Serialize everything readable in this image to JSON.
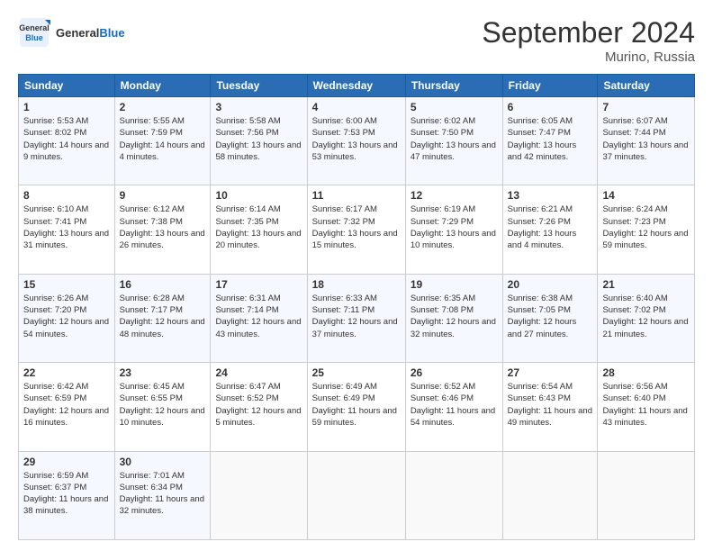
{
  "header": {
    "logo_general": "General",
    "logo_blue": "Blue",
    "month": "September 2024",
    "location": "Murino, Russia"
  },
  "days_of_week": [
    "Sunday",
    "Monday",
    "Tuesday",
    "Wednesday",
    "Thursday",
    "Friday",
    "Saturday"
  ],
  "weeks": [
    [
      {
        "num": "1",
        "sunrise": "5:53 AM",
        "sunset": "8:02 PM",
        "daylight": "14 hours and 9 minutes."
      },
      {
        "num": "2",
        "sunrise": "5:55 AM",
        "sunset": "7:59 PM",
        "daylight": "14 hours and 4 minutes."
      },
      {
        "num": "3",
        "sunrise": "5:58 AM",
        "sunset": "7:56 PM",
        "daylight": "13 hours and 58 minutes."
      },
      {
        "num": "4",
        "sunrise": "6:00 AM",
        "sunset": "7:53 PM",
        "daylight": "13 hours and 53 minutes."
      },
      {
        "num": "5",
        "sunrise": "6:02 AM",
        "sunset": "7:50 PM",
        "daylight": "13 hours and 47 minutes."
      },
      {
        "num": "6",
        "sunrise": "6:05 AM",
        "sunset": "7:47 PM",
        "daylight": "13 hours and 42 minutes."
      },
      {
        "num": "7",
        "sunrise": "6:07 AM",
        "sunset": "7:44 PM",
        "daylight": "13 hours and 37 minutes."
      }
    ],
    [
      {
        "num": "8",
        "sunrise": "6:10 AM",
        "sunset": "7:41 PM",
        "daylight": "13 hours and 31 minutes."
      },
      {
        "num": "9",
        "sunrise": "6:12 AM",
        "sunset": "7:38 PM",
        "daylight": "13 hours and 26 minutes."
      },
      {
        "num": "10",
        "sunrise": "6:14 AM",
        "sunset": "7:35 PM",
        "daylight": "13 hours and 20 minutes."
      },
      {
        "num": "11",
        "sunrise": "6:17 AM",
        "sunset": "7:32 PM",
        "daylight": "13 hours and 15 minutes."
      },
      {
        "num": "12",
        "sunrise": "6:19 AM",
        "sunset": "7:29 PM",
        "daylight": "13 hours and 10 minutes."
      },
      {
        "num": "13",
        "sunrise": "6:21 AM",
        "sunset": "7:26 PM",
        "daylight": "13 hours and 4 minutes."
      },
      {
        "num": "14",
        "sunrise": "6:24 AM",
        "sunset": "7:23 PM",
        "daylight": "12 hours and 59 minutes."
      }
    ],
    [
      {
        "num": "15",
        "sunrise": "6:26 AM",
        "sunset": "7:20 PM",
        "daylight": "12 hours and 54 minutes."
      },
      {
        "num": "16",
        "sunrise": "6:28 AM",
        "sunset": "7:17 PM",
        "daylight": "12 hours and 48 minutes."
      },
      {
        "num": "17",
        "sunrise": "6:31 AM",
        "sunset": "7:14 PM",
        "daylight": "12 hours and 43 minutes."
      },
      {
        "num": "18",
        "sunrise": "6:33 AM",
        "sunset": "7:11 PM",
        "daylight": "12 hours and 37 minutes."
      },
      {
        "num": "19",
        "sunrise": "6:35 AM",
        "sunset": "7:08 PM",
        "daylight": "12 hours and 32 minutes."
      },
      {
        "num": "20",
        "sunrise": "6:38 AM",
        "sunset": "7:05 PM",
        "daylight": "12 hours and 27 minutes."
      },
      {
        "num": "21",
        "sunrise": "6:40 AM",
        "sunset": "7:02 PM",
        "daylight": "12 hours and 21 minutes."
      }
    ],
    [
      {
        "num": "22",
        "sunrise": "6:42 AM",
        "sunset": "6:59 PM",
        "daylight": "12 hours and 16 minutes."
      },
      {
        "num": "23",
        "sunrise": "6:45 AM",
        "sunset": "6:55 PM",
        "daylight": "12 hours and 10 minutes."
      },
      {
        "num": "24",
        "sunrise": "6:47 AM",
        "sunset": "6:52 PM",
        "daylight": "12 hours and 5 minutes."
      },
      {
        "num": "25",
        "sunrise": "6:49 AM",
        "sunset": "6:49 PM",
        "daylight": "11 hours and 59 minutes."
      },
      {
        "num": "26",
        "sunrise": "6:52 AM",
        "sunset": "6:46 PM",
        "daylight": "11 hours and 54 minutes."
      },
      {
        "num": "27",
        "sunrise": "6:54 AM",
        "sunset": "6:43 PM",
        "daylight": "11 hours and 49 minutes."
      },
      {
        "num": "28",
        "sunrise": "6:56 AM",
        "sunset": "6:40 PM",
        "daylight": "11 hours and 43 minutes."
      }
    ],
    [
      {
        "num": "29",
        "sunrise": "6:59 AM",
        "sunset": "6:37 PM",
        "daylight": "11 hours and 38 minutes."
      },
      {
        "num": "30",
        "sunrise": "7:01 AM",
        "sunset": "6:34 PM",
        "daylight": "11 hours and 32 minutes."
      },
      null,
      null,
      null,
      null,
      null
    ]
  ]
}
